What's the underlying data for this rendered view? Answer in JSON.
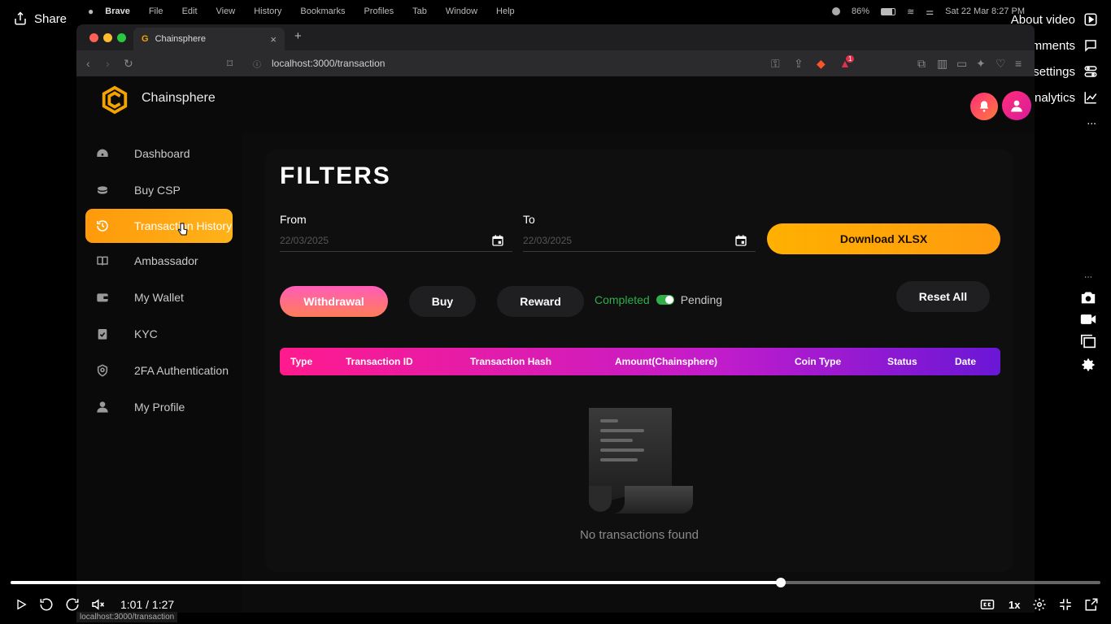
{
  "player": {
    "share_label": "Share",
    "menu": [
      {
        "label": "About video",
        "icon": "play-square-icon"
      },
      {
        "label": "Comments",
        "icon": "comment-icon"
      },
      {
        "label": "Video settings",
        "icon": "settings-toggle-icon"
      },
      {
        "label": "Analytics",
        "icon": "chart-line-icon"
      }
    ],
    "more_label": "...",
    "time": "1:01 / 1:27",
    "progress": 0.707,
    "speed": "1x"
  },
  "menubar": {
    "app": "Brave",
    "items": [
      "File",
      "Edit",
      "View",
      "History",
      "Bookmarks",
      "Profiles",
      "Tab",
      "Window",
      "Help"
    ],
    "battery": "86%",
    "datetime": "Sat 22 Mar  8:27 PM"
  },
  "browser": {
    "tab_title": "Chainsphere",
    "url": "localhost:3000/transaction",
    "status_url": "localhost:3000/transaction",
    "notification_count": "1"
  },
  "app": {
    "brand": "Chainsphere",
    "brand_color": "#f5a300",
    "sidebar": [
      {
        "label": "Dashboard",
        "icon": "gauge-icon"
      },
      {
        "label": "Buy CSP",
        "icon": "coins-icon"
      },
      {
        "label": "Transaction History",
        "icon": "history-icon",
        "active": true
      },
      {
        "label": "Ambassador",
        "icon": "book-icon"
      },
      {
        "label": "My Wallet",
        "icon": "wallet-icon"
      },
      {
        "label": "KYC",
        "icon": "clipboard-check-icon"
      },
      {
        "label": "2FA Authentication",
        "icon": "shield-icon"
      },
      {
        "label": "My Profile",
        "icon": "user-icon"
      }
    ],
    "filters": {
      "title": "FILTERS",
      "from_label": "From",
      "from_value": "22/03/2025",
      "to_label": "To",
      "to_value": "22/03/2025",
      "download_label": "Download XLSX",
      "types": [
        "Withdrawal",
        "Buy",
        "Reward"
      ],
      "status_left": "Completed",
      "status_right": "Pending",
      "reset_label": "Reset All"
    },
    "table": {
      "columns": [
        "Type",
        "Transaction ID",
        "Transaction Hash",
        "Amount(Chainsphere)",
        "Coin Type",
        "Status",
        "Date"
      ]
    },
    "empty_message": "No transactions found"
  }
}
